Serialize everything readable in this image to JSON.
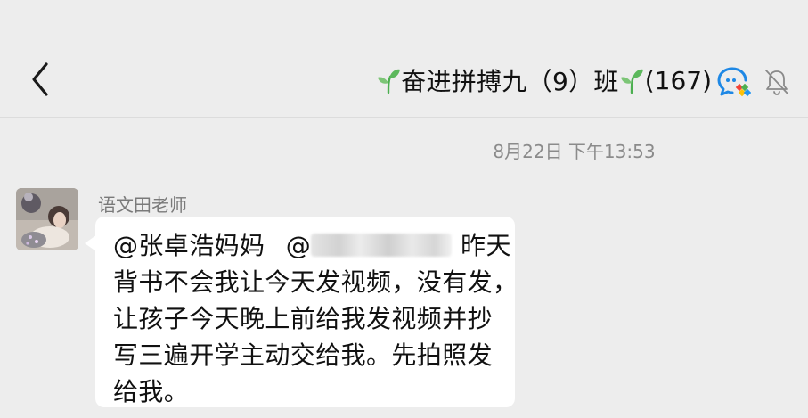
{
  "header": {
    "back_icon": "chevron-left-icon",
    "title": "奋进拼搏九（9）班",
    "member_count": "(167)",
    "leaf_icon": "seedling-icon",
    "chat_icon": "group-chat-icon",
    "mute_icon": "bell-muted-icon"
  },
  "chat": {
    "timestamp": "8月22日 下午13:53",
    "message": {
      "sender": "语文田老师",
      "mention_1": "@张卓浩妈妈",
      "mention_2_prefix": "@",
      "line1_tail": "昨天",
      "line2": "背书不会我让今天发视频，没有发，",
      "line3": "让孩子今天晚上前给我发视频并抄",
      "line4": "写三遍开学主动交给我。先拍照发",
      "line5": "给我。"
    }
  },
  "colors": {
    "background": "#ededed",
    "bubble": "#ffffff",
    "text": "#111111",
    "muted_text": "#8b8b8b",
    "leaf_green": "#4caf50",
    "chat_icon_blue": "#1e88e5"
  }
}
